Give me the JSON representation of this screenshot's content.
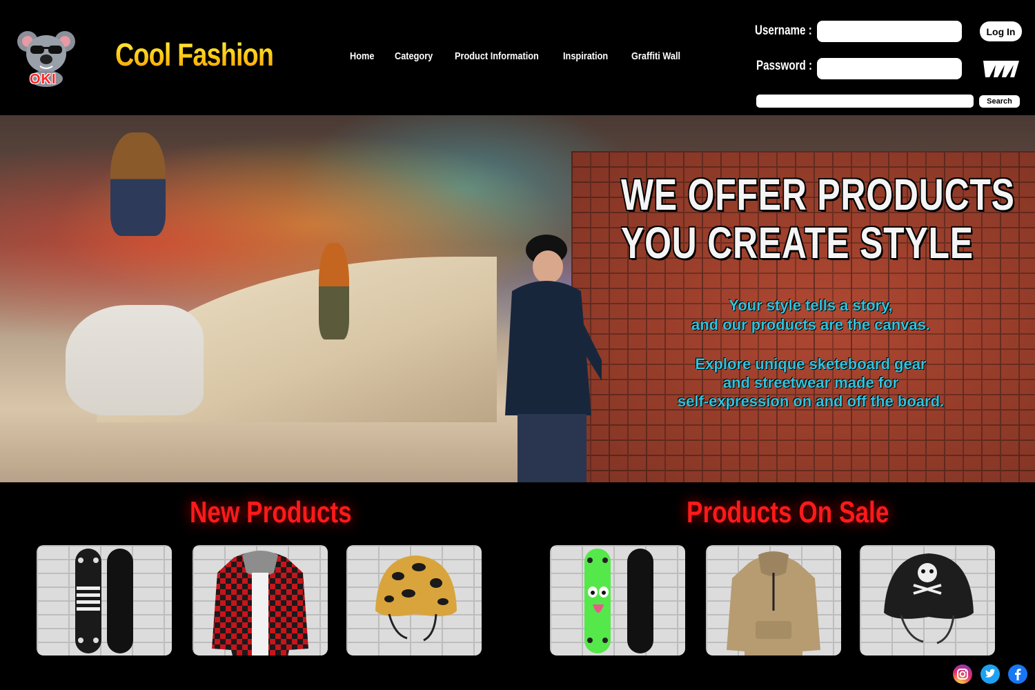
{
  "brand": {
    "logo_text": "OKI",
    "name": "Cool Fashion"
  },
  "nav": {
    "items": [
      "Home",
      "Category",
      "Product Information",
      "Inspiration",
      "Graffiti Wall"
    ]
  },
  "login": {
    "username_label": "Username :",
    "password_label": "Password :",
    "username_value": "",
    "password_value": "",
    "login_label": "Log In"
  },
  "search": {
    "value": "",
    "button_label": "Search"
  },
  "hero": {
    "headline_line1": "WE OFFER PRODUCTS",
    "headline_line2": "YOU CREATE STYLE",
    "text_line1": "Your style tells a story,",
    "text_line2": "and our products are the canvas.",
    "text_line3": "Explore unique sketeboard gear",
    "text_line4": "and streetwear made for",
    "text_line5": "self-expression on and off the board."
  },
  "sections": {
    "new_products": {
      "title": "New Products",
      "items": [
        {
          "icon": "skateboard-black-striped-icon"
        },
        {
          "icon": "red-flannel-hoodie-icon"
        },
        {
          "icon": "leopard-helmet-icon"
        }
      ]
    },
    "on_sale": {
      "title": "Products On Sale",
      "items": [
        {
          "icon": "skateboard-green-monster-icon"
        },
        {
          "icon": "khaki-hoodie-icon"
        },
        {
          "icon": "skull-helmet-icon"
        }
      ]
    }
  },
  "social": [
    "instagram-icon",
    "twitter-icon",
    "facebook-icon"
  ],
  "colors": {
    "accent_red": "#ff1a1a",
    "brand_yellow": "#ffd21a",
    "hero_text_cyan": "#2fc3dd",
    "background": "#000000"
  }
}
